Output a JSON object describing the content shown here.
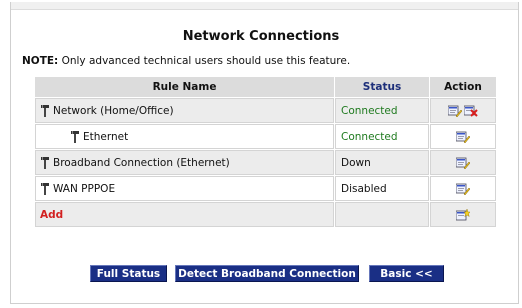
{
  "page": {
    "title": "Network Connections",
    "note_label": "NOTE:",
    "note_text": " Only advanced technical users should use this feature."
  },
  "table": {
    "headers": {
      "name": "Rule Name",
      "status": "Status",
      "action": "Action"
    },
    "rows": [
      {
        "name": "Network (Home/Office)",
        "status": "Connected",
        "status_color": "#1f7a1f",
        "indent": false,
        "actions": [
          "edit-icon",
          "delete-icon"
        ]
      },
      {
        "name": "Ethernet",
        "status": "Connected",
        "status_color": "#1f7a1f",
        "indent": true,
        "actions": [
          "edit-icon"
        ]
      },
      {
        "name": "Broadband Connection (Ethernet)",
        "status": "Down",
        "status_color": "#111111",
        "indent": false,
        "actions": [
          "edit-icon"
        ]
      },
      {
        "name": "WAN PPPOE",
        "status": "Disabled",
        "status_color": "#111111",
        "indent": false,
        "actions": [
          "edit-icon"
        ]
      }
    ],
    "add_label": "Add"
  },
  "buttons": {
    "full_status": "Full Status",
    "detect": "Detect Broadband Connection",
    "basic": "Basic <<"
  },
  "colors": {
    "button_bg": "#1a2f85",
    "add_link": "#d22020",
    "connected": "#1f7a1f",
    "status_header": "#1d2f7a"
  }
}
